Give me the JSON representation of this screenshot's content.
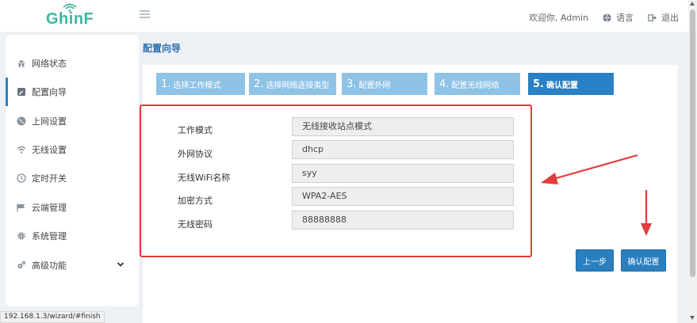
{
  "header": {
    "logo": "GhinF",
    "welcome": "欢迎你, Admin",
    "language": "语言",
    "logout": "退出"
  },
  "sidebar": {
    "items": [
      {
        "label": "网络状态",
        "icon": "home-icon"
      },
      {
        "label": "配置向导",
        "icon": "wizard-icon",
        "active": true
      },
      {
        "label": "上网设置",
        "icon": "globe-icon"
      },
      {
        "label": "无线设置",
        "icon": "wifi-icon"
      },
      {
        "label": "定时开关",
        "icon": "clock-icon"
      },
      {
        "label": "云端管理",
        "icon": "cloud-flag-icon"
      },
      {
        "label": "系统管理",
        "icon": "gear-icon"
      },
      {
        "label": "高级功能",
        "icon": "gears-icon",
        "expandable": true
      }
    ]
  },
  "page": {
    "title": "配置向导"
  },
  "steps": [
    {
      "num": "1.",
      "label": "选择工作模式"
    },
    {
      "num": "2.",
      "label": "选择网络连接类型"
    },
    {
      "num": "3.",
      "label": "配置外网"
    },
    {
      "num": "4.",
      "label": "配置无线网络"
    },
    {
      "num": "5.",
      "label": "确认配置",
      "active": true
    }
  ],
  "summary": [
    {
      "label": "工作模式",
      "value": "无线接收站点模式"
    },
    {
      "label": "外网协议",
      "value": "dhcp"
    },
    {
      "label": "无线WiFi名称",
      "value": "syy"
    },
    {
      "label": "加密方式",
      "value": "WPA2-AES"
    },
    {
      "label": "无线密码",
      "value": "88888888"
    }
  ],
  "buttons": {
    "prev": "上一步",
    "confirm": "确认配置"
  },
  "status_url": "192.168.1.3/wizard/#finish",
  "colors": {
    "accent": "#2a7fc0",
    "step_inactive": "#8fc3e6",
    "highlight": "#e23b3b",
    "logo": "#41b6a0"
  }
}
